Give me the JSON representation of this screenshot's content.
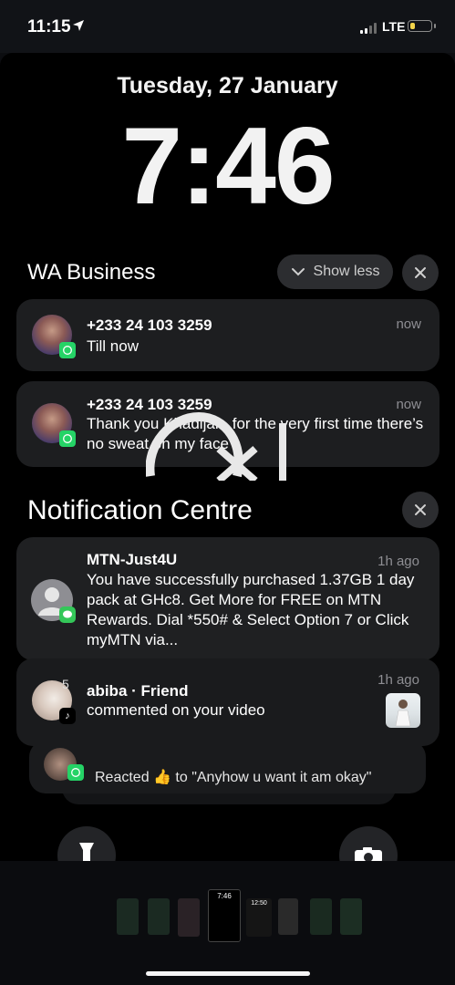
{
  "status_bar": {
    "time": "11:15",
    "network": "LTE",
    "signal_bars_active": 2,
    "signal_bars_total": 4,
    "battery_level": 0.2,
    "battery_color": "#f4d44a"
  },
  "lock_screen": {
    "date": "Tuesday, 27 January",
    "time": "7:46"
  },
  "wa_group": {
    "title": "WA Business",
    "show_less_label": "Show less",
    "notifications": [
      {
        "sender": "+233 24 103 3259",
        "time": "now",
        "body": "Till now"
      },
      {
        "sender": "+233 24 103 3259",
        "time": "now",
        "body": "Thank you Khadijah, for the very first time there’s no sweat on my face ."
      }
    ]
  },
  "notification_centre": {
    "title": "Notification Centre",
    "notifications": [
      {
        "sender": "MTN-Just4U",
        "time": "1h ago",
        "body": "You have successfully purchased 1.37GB 1 day pack at GHc8. Get More for FREE on MTN Rewards. Dial *550# & Select Option 7 or Click myMTN via..."
      },
      {
        "sender": "abiba · Friend",
        "time": "1h ago",
        "body": "commented on your video",
        "count": "5"
      }
    ],
    "stacked_preview": "Reacted 👍 to \"Anyhow u want it am okay\""
  },
  "app_switcher": {
    "center_thumb_time": "7:46",
    "next_thumb_time": "12:50"
  },
  "colors": {
    "whatsapp_green": "#25d366",
    "card_bg": "#1d1e20",
    "accent_gray": "#2c2d30"
  }
}
